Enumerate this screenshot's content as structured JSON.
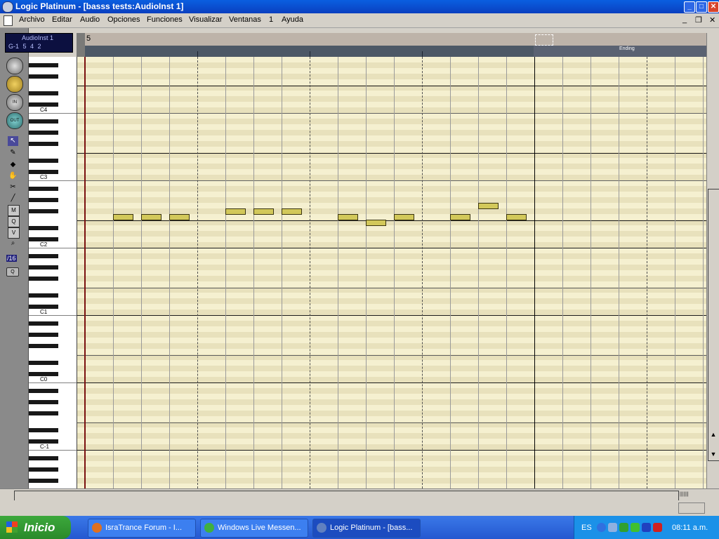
{
  "window": {
    "title": "Logic Platinum - [basss tests:AudioInst  1]",
    "minimize": "_",
    "maximize": "□",
    "close": "✕"
  },
  "menu": {
    "items": [
      "Archivo",
      "Editar",
      "Audio",
      "Opciones",
      "Funciones",
      "Visualizar",
      "Ventanas",
      "1",
      "Ayuda"
    ],
    "mdi_minimize": "_",
    "mdi_restore": "❐",
    "mdi_close": "✕"
  },
  "track": {
    "name": "AudioInst  1",
    "pitch": "G-1",
    "position": "5  4  2"
  },
  "tools": {
    "in_label": "IN",
    "out_label": "OUT",
    "quantize": "/16",
    "q_button": "Q",
    "icons": [
      "pointer-icon",
      "pencil-icon",
      "eraser-icon",
      "hand-icon",
      "scissors-icon",
      "glue-icon",
      "mute-icon",
      "magnifier-icon",
      "velocity-icon",
      "zoom-icon"
    ]
  },
  "keyboard": {
    "octave_labels": [
      "C4",
      "C3",
      "C2",
      "C1",
      "C0",
      "C-1"
    ]
  },
  "ruler": {
    "start_bar": "5",
    "end_label": "Ending"
  },
  "piano_roll": {
    "notes": [
      {
        "beat": 1,
        "pitch": "F2"
      },
      {
        "beat": 2,
        "pitch": "F2"
      },
      {
        "beat": 3,
        "pitch": "F2"
      },
      {
        "beat": 5,
        "pitch": "F#2"
      },
      {
        "beat": 6,
        "pitch": "F#2"
      },
      {
        "beat": 7,
        "pitch": "F#2"
      },
      {
        "beat": 9,
        "pitch": "F2"
      },
      {
        "beat": 10,
        "pitch": "E2"
      },
      {
        "beat": 11,
        "pitch": "F2"
      },
      {
        "beat": 13,
        "pitch": "F2"
      },
      {
        "beat": 14,
        "pitch": "G2"
      },
      {
        "beat": 15,
        "pitch": "F2"
      }
    ]
  },
  "scroll": {
    "up": "▲",
    "down": "▼",
    "grip": "|||||||"
  },
  "taskbar": {
    "start": "Inicio",
    "buttons": [
      {
        "label": "IsraTrance Forum - I...",
        "icon_color": "#e07020"
      },
      {
        "label": "Windows Live Messen...",
        "icon_color": "#40b040"
      },
      {
        "label": "Logic Platinum - [bass...",
        "icon_color": "#6080c0"
      }
    ],
    "tray": {
      "language": "ES",
      "clock": "08:11 a.m."
    }
  }
}
